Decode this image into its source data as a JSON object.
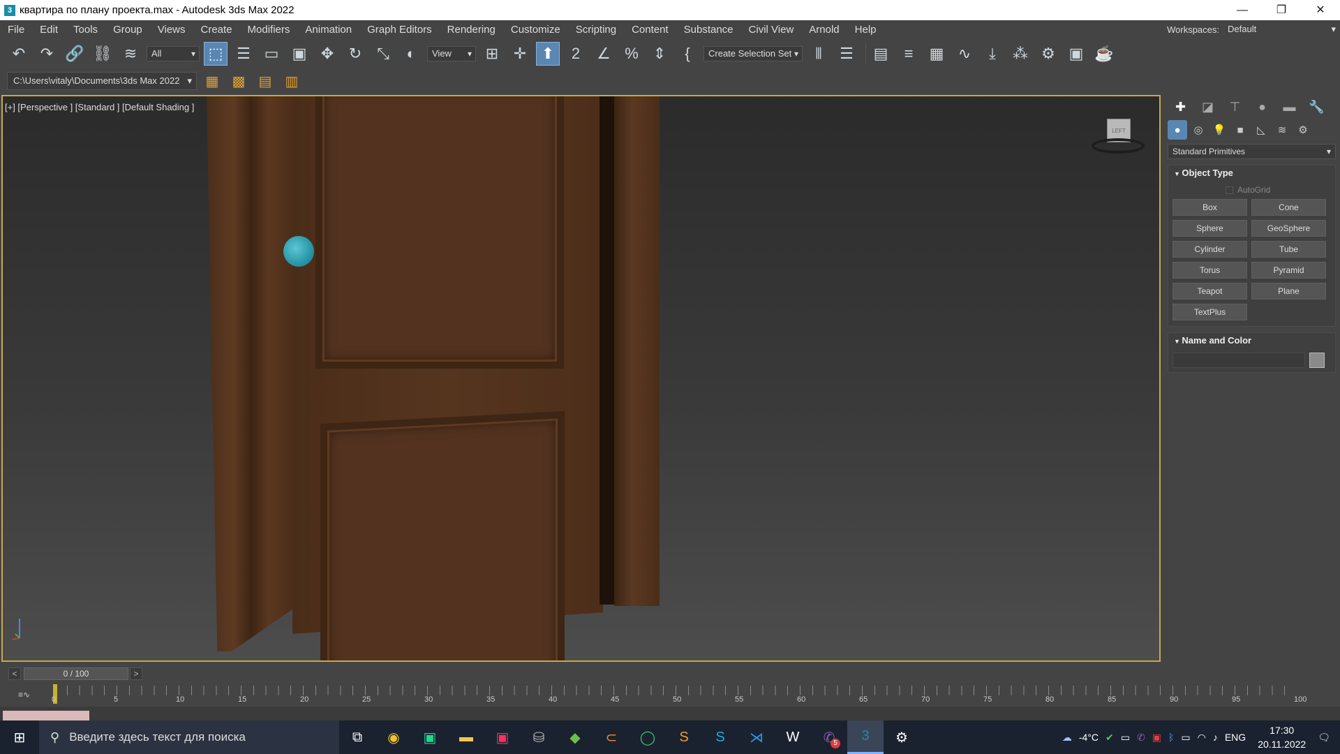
{
  "window": {
    "title": "квартира по плану проекта.max - Autodesk 3ds Max 2022",
    "app_icon": "3",
    "buttons": {
      "minimize": "—",
      "restore": "❐",
      "close": "✕"
    }
  },
  "menu": {
    "items": [
      "File",
      "Edit",
      "Tools",
      "Group",
      "Views",
      "Create",
      "Modifiers",
      "Animation",
      "Graph Editors",
      "Rendering",
      "Customize",
      "Scripting",
      "Content",
      "Substance",
      "Civil View",
      "Arnold",
      "Help"
    ],
    "workspaces_label": "Workspaces:",
    "workspaces_value": "Default"
  },
  "toolbar": {
    "filter_value": "All",
    "refcoord_value": "View",
    "selection_set": "Create Selection Set"
  },
  "pathbar": {
    "project_path": "C:\\Users\\vitaly\\Documents\\3ds Max 2022"
  },
  "viewport": {
    "label": "[+] [Perspective ] [Standard ] [Default Shading ]",
    "viewcube_text": "LEFT"
  },
  "command_panel": {
    "category": "Standard Primitives",
    "object_type_title": "Object Type",
    "autogrid_label": "AutoGrid",
    "buttons": [
      "Box",
      "Cone",
      "Sphere",
      "GeoSphere",
      "Cylinder",
      "Tube",
      "Torus",
      "Pyramid",
      "Teapot",
      "Plane",
      "TextPlus"
    ],
    "name_color_title": "Name and Color"
  },
  "timeline": {
    "frame_readout": "0 / 100",
    "ticks": [
      "0",
      "5",
      "10",
      "15",
      "20",
      "25",
      "30",
      "35",
      "40",
      "45",
      "50",
      "55",
      "60",
      "65",
      "70",
      "75",
      "80",
      "85",
      "90",
      "95",
      "100"
    ]
  },
  "taskbar": {
    "search_placeholder": "Введите здесь текст для поиска",
    "weather": "-4°C",
    "language": "ENG",
    "time": "17:30",
    "date": "20.11.2022",
    "viber_badge": "5"
  },
  "colors": {
    "accent": "#5a86b3",
    "viewport_border": "#c8a94a",
    "door": "#56351f",
    "knob": "#2d9aac"
  }
}
